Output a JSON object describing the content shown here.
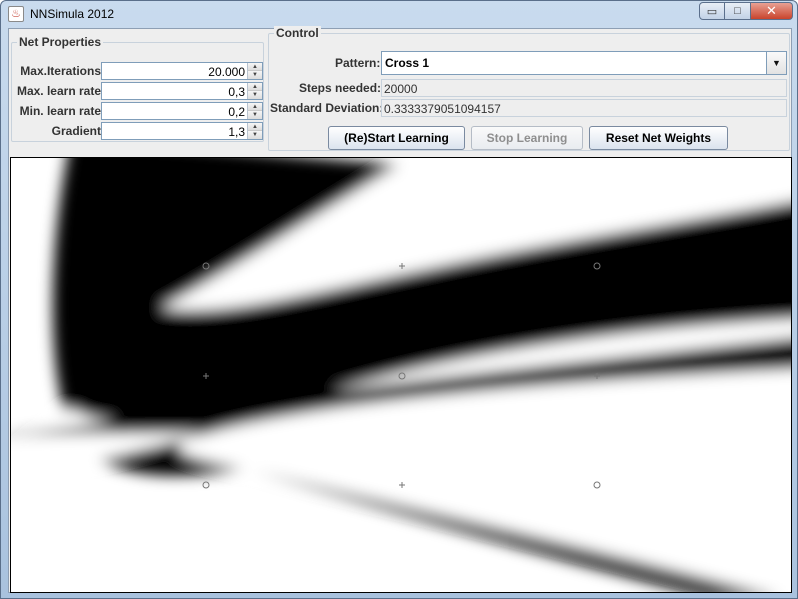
{
  "window": {
    "title": "NNSimula 2012",
    "min_symbol": "▭",
    "max_symbol": "□",
    "close_symbol": "✕",
    "app_icon_glyph": "♨"
  },
  "net_properties": {
    "title": "Net Properties",
    "rows": [
      {
        "label": "Max.Iterations",
        "value": "20.000"
      },
      {
        "label": "Max. learn rate",
        "value": "0,3"
      },
      {
        "label": "Min. learn rate",
        "value": "0,2"
      },
      {
        "label": "Gradient",
        "value": "1,3"
      }
    ]
  },
  "control": {
    "title": "Control",
    "pattern_label": "Pattern:",
    "pattern_value": "Cross 1",
    "steps_label": "Steps needed:",
    "steps_value": "20000",
    "stddev_label": "Standard Deviation:",
    "stddev_value": "0.3333379051094157",
    "buttons": {
      "start": "(Re)Start Learning",
      "stop": "Stop Learning",
      "reset": "Reset Net Weights"
    }
  },
  "canvas": {
    "markers": [
      {
        "type": "circle",
        "col": 0,
        "row": 0
      },
      {
        "type": "plus",
        "col": 1,
        "row": 0
      },
      {
        "type": "circle",
        "col": 2,
        "row": 0
      },
      {
        "type": "plus",
        "col": 0,
        "row": 1
      },
      {
        "type": "circle",
        "col": 1,
        "row": 1
      },
      {
        "type": "plus",
        "col": 2,
        "row": 1
      },
      {
        "type": "circle",
        "col": 0,
        "row": 2
      },
      {
        "type": "plus",
        "col": 1,
        "row": 2
      },
      {
        "type": "circle",
        "col": 2,
        "row": 2
      }
    ]
  }
}
